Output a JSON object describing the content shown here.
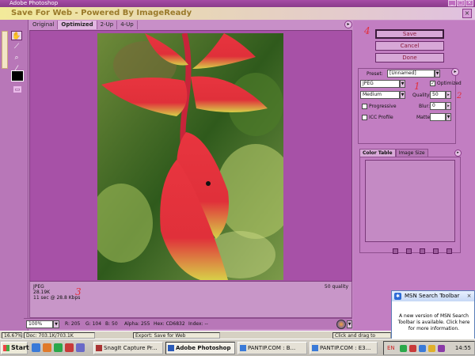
{
  "app": {
    "title": "Adobe Photoshop"
  },
  "dialog": {
    "title": "Save For Web - Powered By ImageReady"
  },
  "tabs": [
    {
      "label": "Original"
    },
    {
      "label": "Optimized"
    },
    {
      "label": "2-Up"
    },
    {
      "label": "4-Up"
    }
  ],
  "buttons": {
    "save": "Save",
    "cancel": "Cancel",
    "done": "Done"
  },
  "settings": {
    "preset_label": "Preset:",
    "preset_value": "[Unnamed]",
    "format_value": "JPEG",
    "optimized_label": "Optimized",
    "compression_value": "Medium",
    "quality_label": "Quality:",
    "quality_value": "50",
    "progressive_label": "Progressive",
    "blur_label": "Blur:",
    "blur_value": "0",
    "icc_label": "ICC Profile",
    "matte_label": "Matte:"
  },
  "panel_tabs": [
    {
      "label": "Color Table"
    },
    {
      "label": "Image Size"
    }
  ],
  "info": {
    "format": "JPEG",
    "size": "28.19K",
    "time": "11 sec @ 28.8 Kbps",
    "quality": "50 quality"
  },
  "annotations": {
    "mark1": "1",
    "mark2": "2",
    "mark3": "3",
    "mark4": "4"
  },
  "statusbar": {
    "zoom": "100%",
    "r": "R:  205",
    "g": "G:  104",
    "b": "B:   50",
    "alpha": "Alpha:  255",
    "hex": "Hex:   CD6832",
    "index": "Index:   --"
  },
  "ps_status": {
    "zoom": "16.67%",
    "doc": "Doc: 703.1K/703.1K",
    "message": "Export: Save for Web",
    "hint": "Click and drag to"
  },
  "msn": {
    "title": "MSN Search Toolbar",
    "message": "A new version of MSN Search Toolbar is available. Click here for more information."
  },
  "taskbar": {
    "start": "Start",
    "tasks": [
      {
        "label": "SnagIt Capture Pr..."
      },
      {
        "label": "Adobe Photoshop"
      },
      {
        "label": "PANTIP.COM : B..."
      },
      {
        "label": "PANTIP.COM : E3..."
      }
    ],
    "lang": "EN",
    "clock": "14:55"
  },
  "icons": {
    "hand": "hand-icon",
    "slice": "slice-select-icon",
    "zoom": "zoom-icon",
    "eyedropper": "eyedropper-icon",
    "browser": "preview-in-browser-icon"
  },
  "colors": {
    "accent": "#e2303e",
    "panel": "#c27ec2",
    "view": "#a751a7"
  }
}
